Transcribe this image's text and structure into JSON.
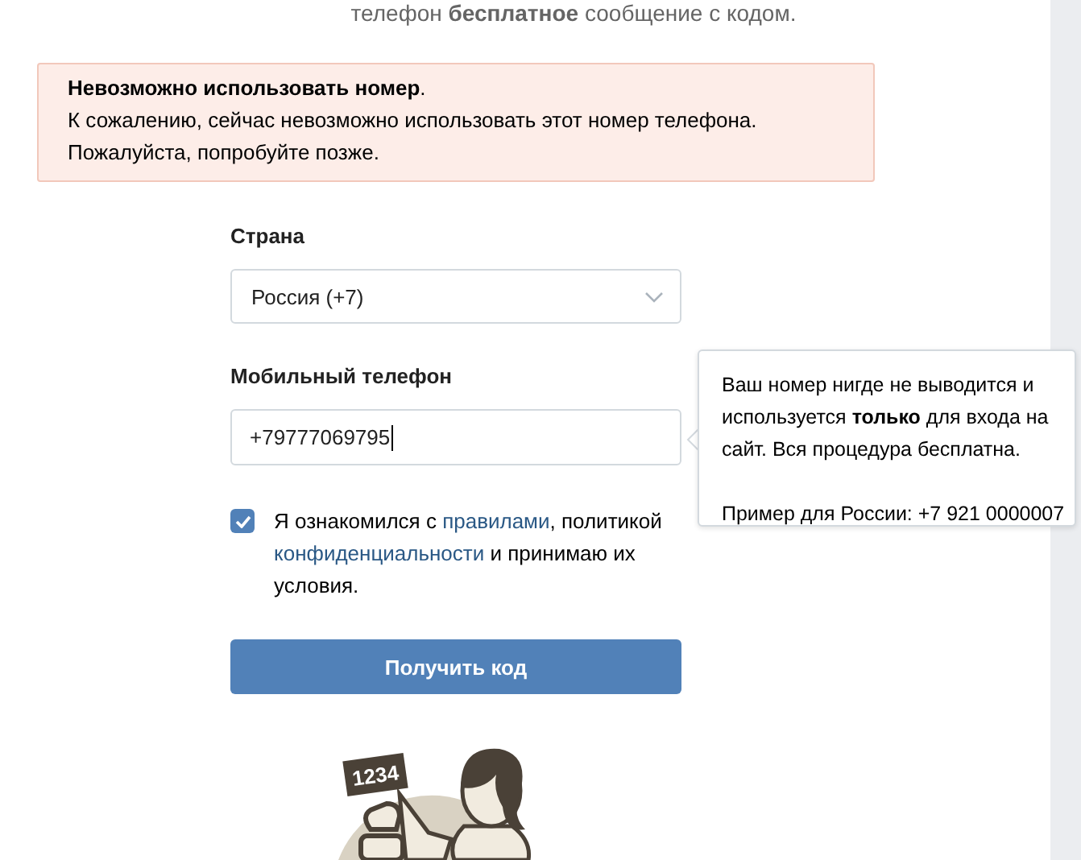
{
  "intro": {
    "text": "телефон **бесплатное** сообщение с кодом."
  },
  "error": {
    "title": "Невозможно использовать номер",
    "title_end": ".",
    "lines": [
      "К сожалению, сейчас невозможно использовать этот номер телефона.",
      "Пожалуйста, попробуйте позже."
    ]
  },
  "country": {
    "label": "Страна",
    "value": "Россия (+7)"
  },
  "phone": {
    "label": "Мобильный телефон",
    "value": "+79777069795"
  },
  "tooltip": {
    "paragraphs": [
      "Ваш номер нигде не выводится и используется **только** для входа на сайт. Вся процедура бесплатна.",
      "Пример для России: +7 921 0000007"
    ]
  },
  "agreement": {
    "checked": true,
    "parts": [
      {
        "kind": "text",
        "text": "Я ознакомился с "
      },
      {
        "kind": "link",
        "text": "правилами"
      },
      {
        "kind": "text",
        "text": ", политикой "
      },
      {
        "kind": "link",
        "text": "конфиденциальности"
      },
      {
        "kind": "text",
        "text": " и принимаю их условия."
      }
    ]
  },
  "submit": {
    "label": "Получить код"
  },
  "illustration": {
    "sign": "1234"
  }
}
